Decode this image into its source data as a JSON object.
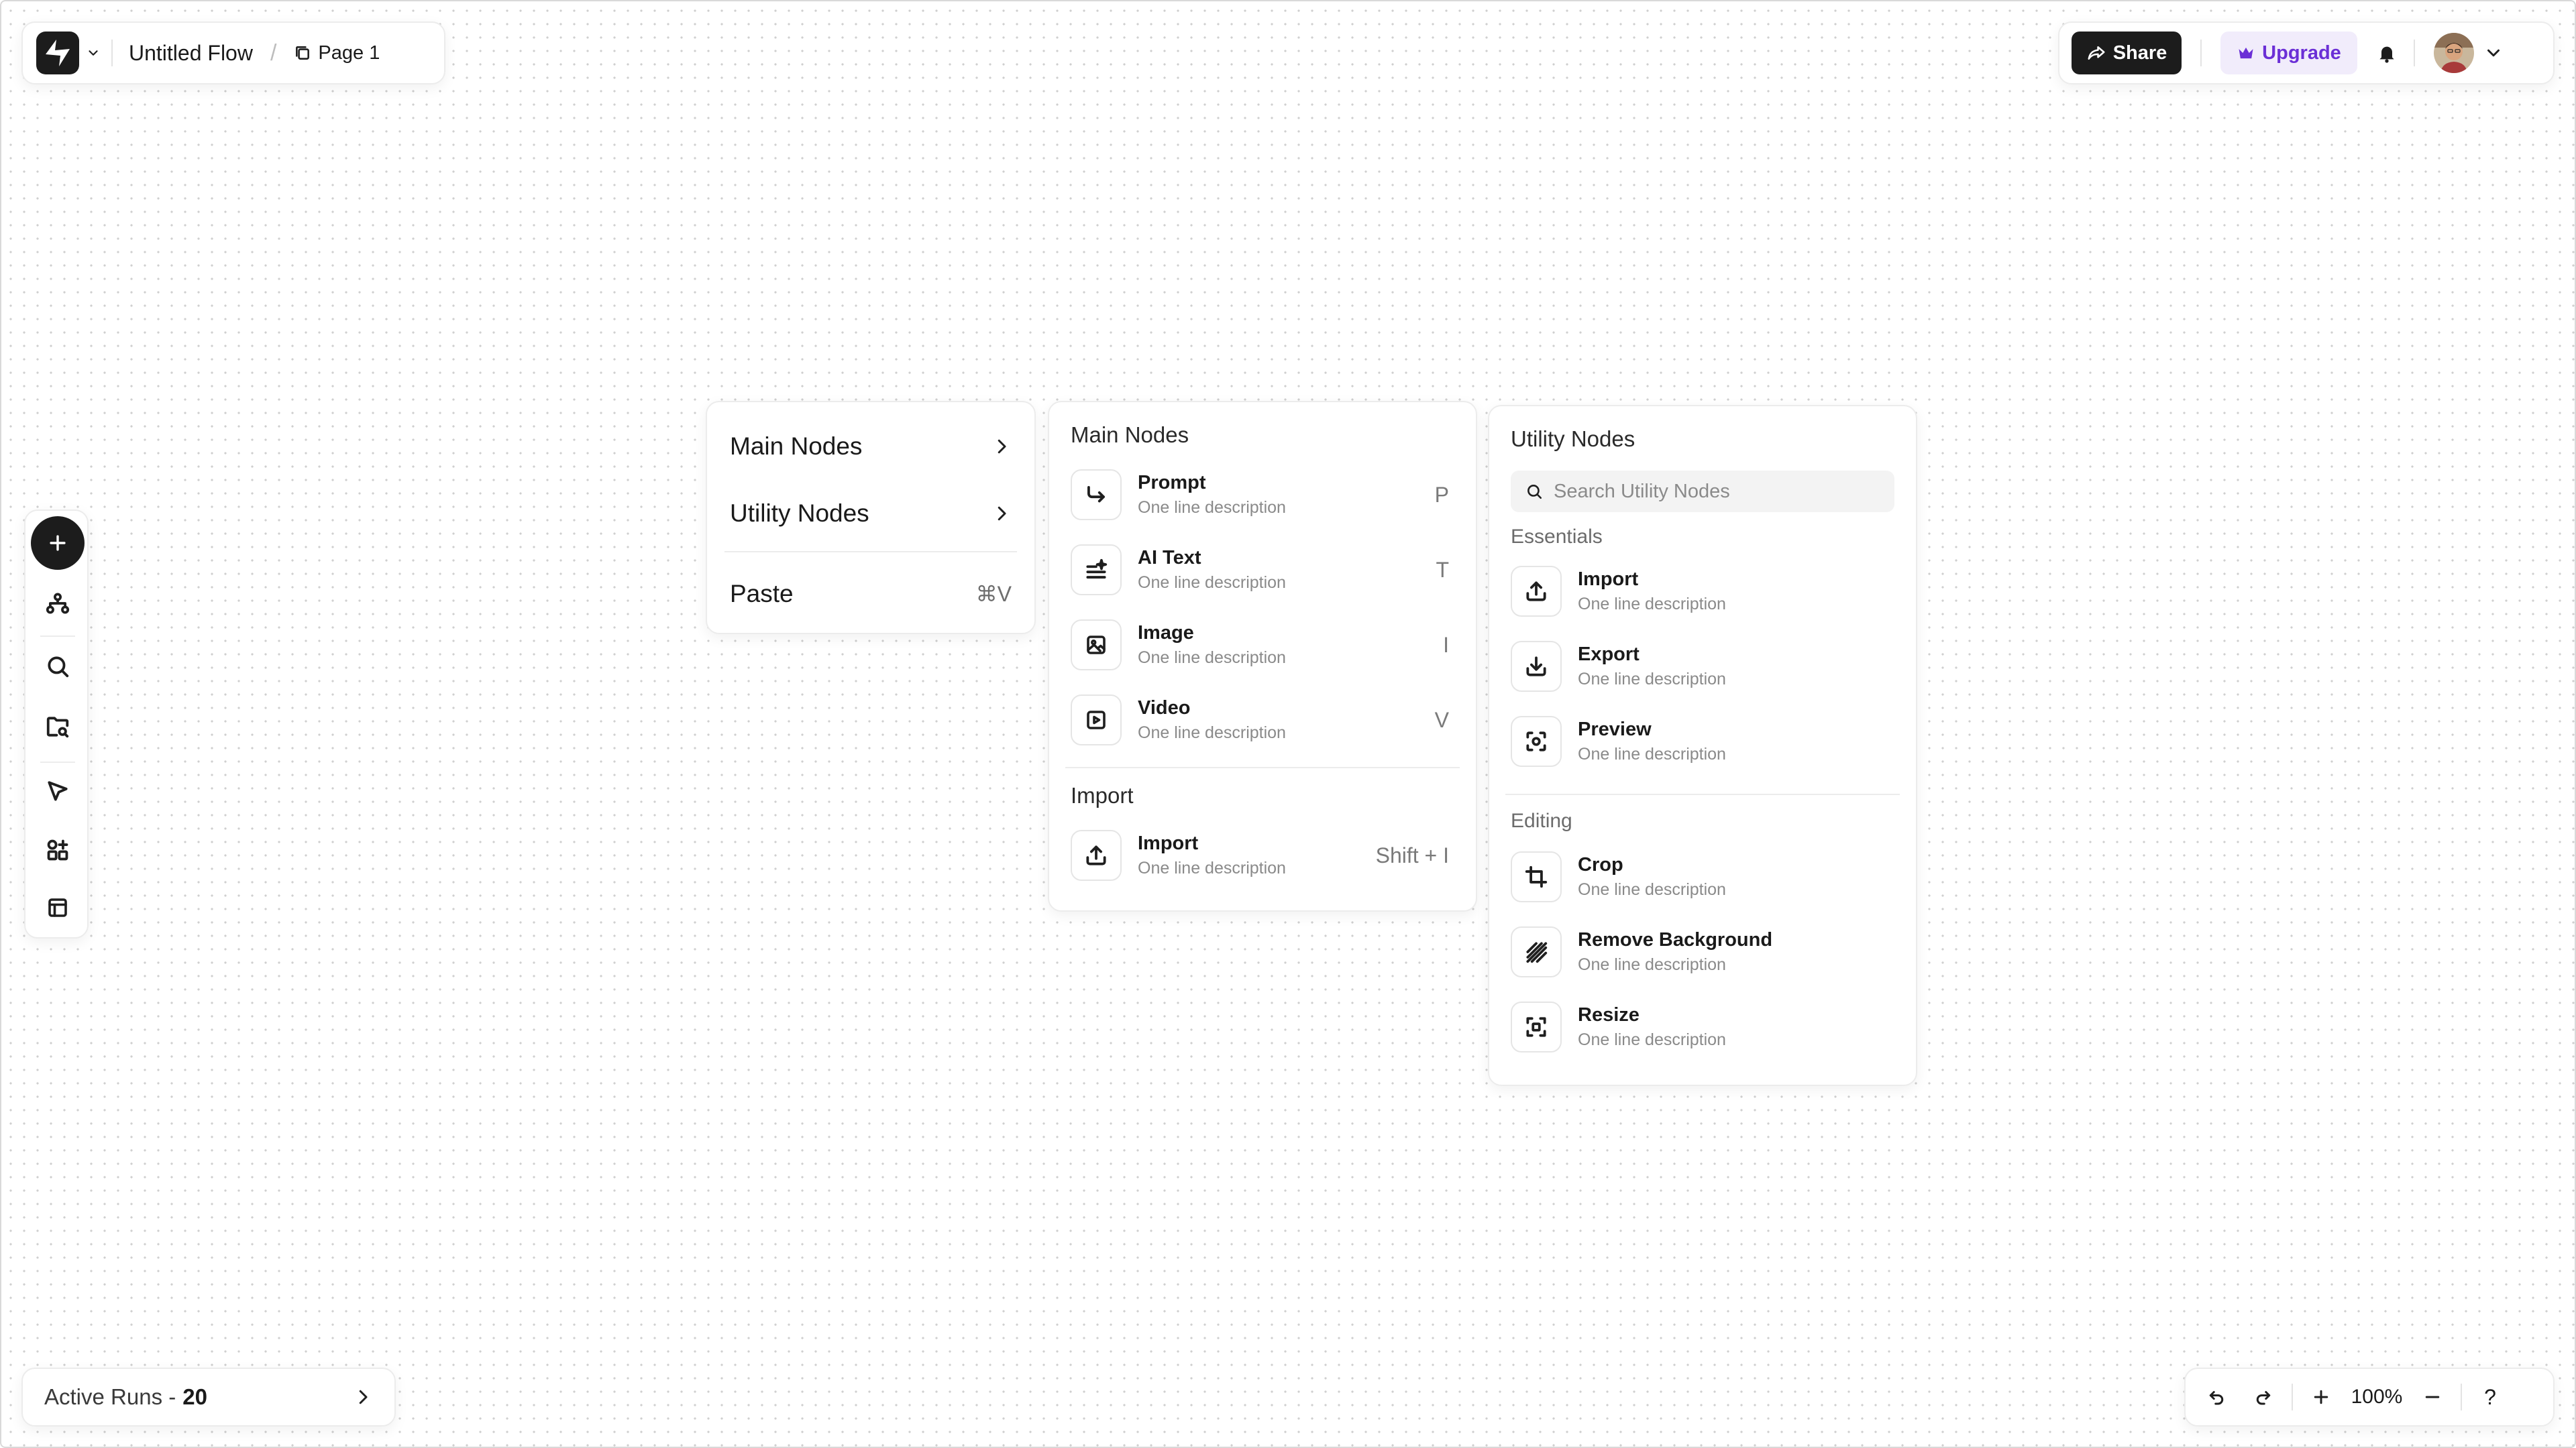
{
  "header": {
    "flow_title": "Untitled Flow",
    "separator": "/",
    "page_label": "Page 1",
    "share_label": "Share",
    "upgrade_label": "Upgrade"
  },
  "toolbar": {
    "tools": [
      "add-node",
      "workflow",
      "search",
      "files",
      "select",
      "components",
      "templates"
    ]
  },
  "context_menu": {
    "items": [
      {
        "label": "Main Nodes"
      },
      {
        "label": "Utility Nodes"
      }
    ],
    "paste_label": "Paste",
    "paste_shortcut": "⌘V"
  },
  "main_nodes": {
    "title": "Main Nodes",
    "items": [
      {
        "name": "Prompt",
        "description": "One line description",
        "shortcut": "P",
        "icon": "prompt-icon"
      },
      {
        "name": "AI Text",
        "description": "One line description",
        "shortcut": "T",
        "icon": "ai-text-icon"
      },
      {
        "name": "Image",
        "description": "One line description",
        "shortcut": "I",
        "icon": "image-icon"
      },
      {
        "name": "Video",
        "description": "One line description",
        "shortcut": "V",
        "icon": "video-icon"
      }
    ],
    "import_title": "Import",
    "import_item": {
      "name": "Import",
      "description": "One line description",
      "shortcut": "Shift + I",
      "icon": "upload-icon"
    }
  },
  "utility_nodes": {
    "title": "Utility Nodes",
    "search_placeholder": "Search Utility Nodes",
    "essentials_title": "Essentials",
    "essentials": [
      {
        "name": "Import",
        "description": "One line description",
        "icon": "upload-icon"
      },
      {
        "name": "Export",
        "description": "One line description",
        "icon": "download-icon"
      },
      {
        "name": "Preview",
        "description": "One line description",
        "icon": "preview-icon"
      }
    ],
    "editing_title": "Editing",
    "editing": [
      {
        "name": "Crop",
        "description": "One line description",
        "icon": "crop-icon"
      },
      {
        "name": "Remove Background",
        "description": "One line description",
        "icon": "remove-background-icon"
      },
      {
        "name": "Resize",
        "description": "One line description",
        "icon": "resize-icon"
      }
    ]
  },
  "footer": {
    "active_runs_label": "Active Runs -",
    "active_runs_count": "20",
    "zoom": "100%",
    "help": "?"
  },
  "colors": {
    "accent_dark": "#1c1c1c",
    "upgrade_bg": "#f1ecfb",
    "upgrade_text": "#6b2fd6"
  }
}
